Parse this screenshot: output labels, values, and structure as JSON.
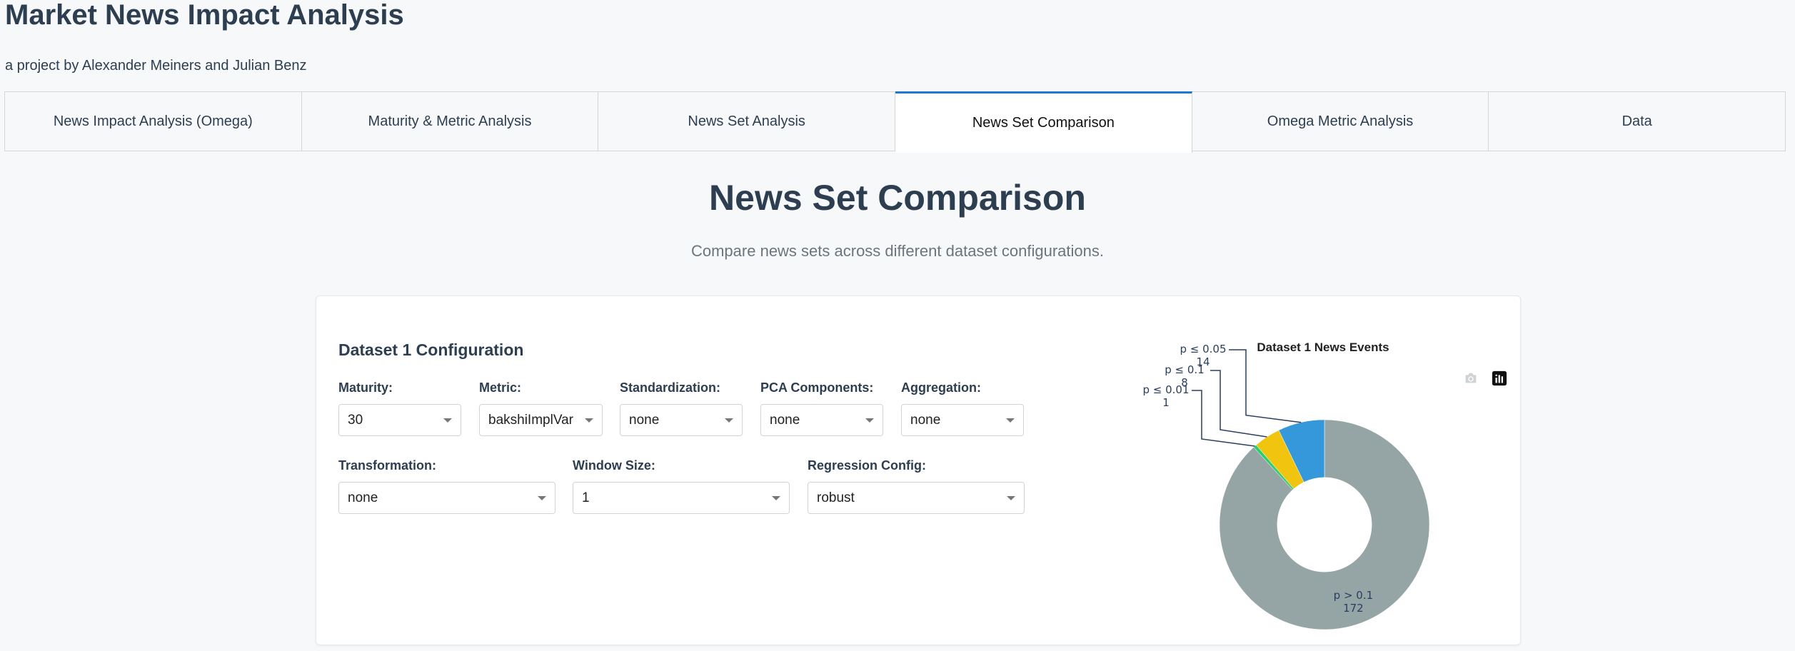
{
  "app": {
    "title": "Market News Impact Analysis",
    "subtitle": "a project by Alexander Meiners and Julian Benz"
  },
  "tabs": [
    {
      "label": "News Impact Analysis (Omega)",
      "active": false
    },
    {
      "label": "Maturity & Metric Analysis",
      "active": false
    },
    {
      "label": "News Set Analysis",
      "active": false
    },
    {
      "label": "News Set Comparison",
      "active": true
    },
    {
      "label": "Omega Metric Analysis",
      "active": false
    },
    {
      "label": "Data",
      "active": false
    }
  ],
  "page": {
    "heading": "News Set Comparison",
    "description": "Compare news sets across different dataset configurations."
  },
  "config": {
    "title": "Dataset 1 Configuration",
    "fields": {
      "maturity": {
        "label": "Maturity:",
        "value": "30"
      },
      "metric": {
        "label": "Metric:",
        "value": "bakshiImplVar"
      },
      "standardization": {
        "label": "Standardization:",
        "value": "none"
      },
      "pca": {
        "label": "PCA Components:",
        "value": "none"
      },
      "aggregation": {
        "label": "Aggregation:",
        "value": "none"
      },
      "transformation": {
        "label": "Transformation:",
        "value": "none"
      },
      "window": {
        "label": "Window Size:",
        "value": "1"
      },
      "regression": {
        "label": "Regression Config:",
        "value": "robust"
      }
    }
  },
  "chart_data": {
    "type": "pie",
    "title": "Dataset 1 News Events",
    "hole": 0.3,
    "slices": [
      {
        "label": "p > 0.1",
        "value": 172,
        "color": "#95a5a6"
      },
      {
        "label": "p ≤ 0.01",
        "value": 1,
        "color": "#2ecc71"
      },
      {
        "label": "p ≤ 0.1",
        "value": 8,
        "color": "#f1c40f"
      },
      {
        "label": "p ≤ 0.05",
        "value": 14,
        "color": "#3498db"
      }
    ]
  },
  "modebar": {
    "icons": [
      "camera-icon",
      "plotly-logo-icon"
    ]
  }
}
